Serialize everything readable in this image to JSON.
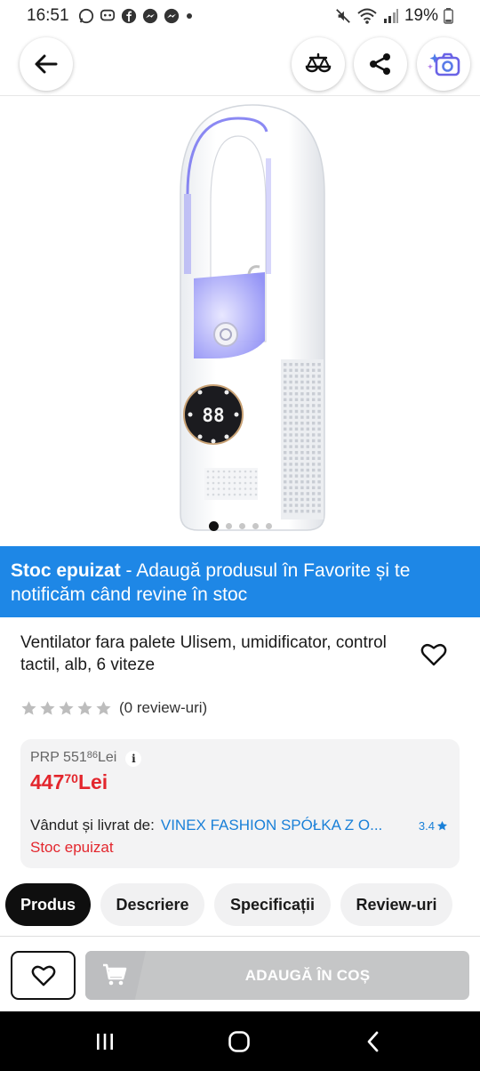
{
  "status_bar": {
    "time": "16:51",
    "battery": "19%"
  },
  "nav": {
    "icons": [
      "back-arrow-icon",
      "compare-icon",
      "share-icon",
      "camera-search-icon"
    ]
  },
  "gallery": {
    "image_count": 5,
    "active_index": 0
  },
  "banner": {
    "bold": "Stoc epuizat",
    "text": " - Adaugă produsul în Favorite și te notificăm când revine în stoc"
  },
  "product": {
    "title": "Ventilator fara palete Ulisem, umidificator, control tactil, alb, 6 viteze",
    "rating_stars": 0,
    "reviews": "(0 review-uri)"
  },
  "pricing": {
    "prp_label": "PRP 551",
    "prp_decimals": "86",
    "prp_currency": " Lei",
    "price_int": "447",
    "price_decimals": "70",
    "price_currency": " Lei",
    "seller_label": "Vândut și livrat de:",
    "seller_name": "VINEX FASHION SPÓŁKA Z O...",
    "seller_rating": "3.4",
    "stock_status": "Stoc epuizat"
  },
  "tabs": [
    {
      "label": "Produs",
      "active": true
    },
    {
      "label": "Descriere",
      "active": false
    },
    {
      "label": "Specificații",
      "active": false
    },
    {
      "label": "Review-uri",
      "active": false
    }
  ],
  "actions": {
    "cart_label": "ADAUGĂ ÎN COȘ"
  },
  "colors": {
    "banner": "#1e87e6",
    "price": "#e3262d",
    "seller": "#1a80d8",
    "cart_disabled": "#c5c6c7"
  }
}
